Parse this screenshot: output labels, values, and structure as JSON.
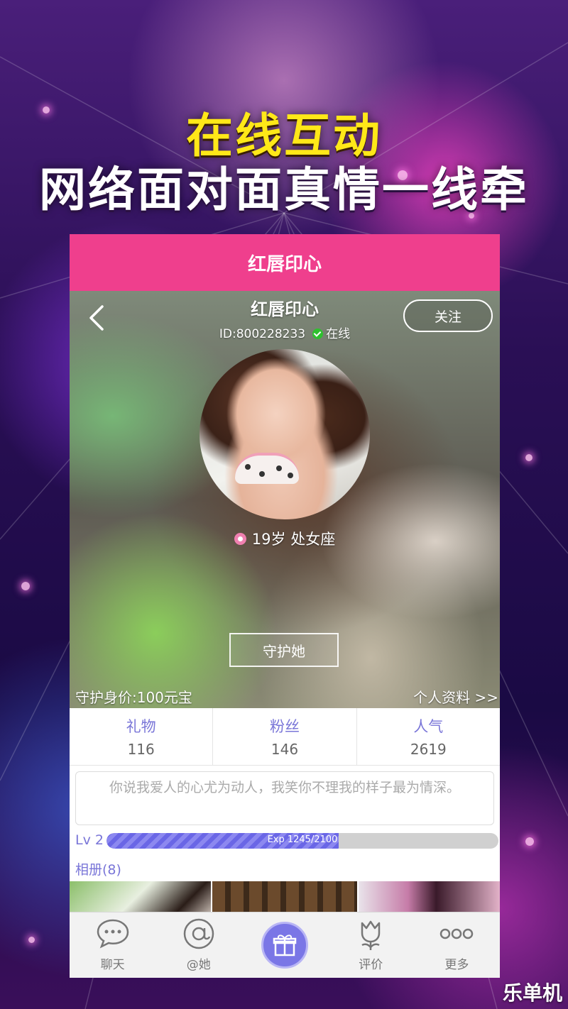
{
  "promo": {
    "line1": "在线互动",
    "line2": "网络面对面真情一线牵"
  },
  "app": {
    "title": "红唇印心"
  },
  "profile": {
    "name": "红唇印心",
    "id_text": "ID:800228233",
    "status": "在线",
    "follow_label": "关注",
    "meta": "19岁  处女座",
    "guard_label": "守护她",
    "guard_price": "守护身价:100元宝",
    "profile_link": "个人资料 >>"
  },
  "stats": [
    {
      "label": "礼物",
      "value": "116"
    },
    {
      "label": "粉丝",
      "value": "146"
    },
    {
      "label": "人气",
      "value": "2619"
    }
  ],
  "signature": "你说我爱人的心尤为动人，我笑你不理我的样子最为情深。",
  "level": {
    "label": "Lv 2",
    "exp_text": "Exp 1245/2100",
    "progress": 0.5929
  },
  "album": {
    "title": "相册(8)"
  },
  "tabs": [
    {
      "label": "聊天",
      "icon": "chat-bubble-icon"
    },
    {
      "label": "@她",
      "icon": "at-icon"
    },
    {
      "label": "",
      "icon": "gift-icon"
    },
    {
      "label": "评价",
      "icon": "flower-icon"
    },
    {
      "label": "更多",
      "icon": "more-dots-icon"
    }
  ],
  "watermark": "乐单机",
  "colors": {
    "accent_pink": "#ef3f8d",
    "accent_purple": "#7a76d8",
    "online_green": "#2ec02e",
    "promo_yellow": "#ffe818"
  }
}
